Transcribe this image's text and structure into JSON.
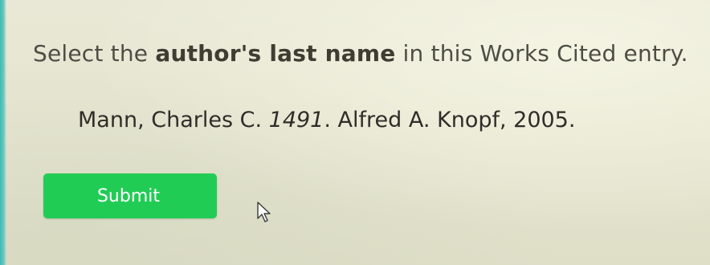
{
  "question": {
    "prefix": "Select the ",
    "emphasis": "author's last name",
    "suffix": " in this Works Cited entry."
  },
  "entry": {
    "author_last": "Mann",
    "author_rest": ", Charles C. ",
    "title": "1491",
    "rest": ". Alfred A. Knopf, 2005."
  },
  "submit_label": "Submit",
  "colors": {
    "submit_bg": "#21cc55",
    "accent_edge": "#3fb9b1"
  },
  "icons": {
    "cursor": "arrow-pointer-icon"
  }
}
